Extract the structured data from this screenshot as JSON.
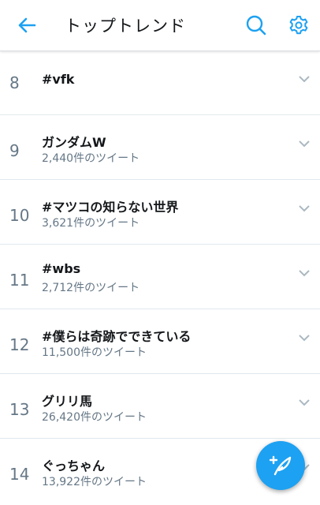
{
  "header": {
    "title": "トップトレンド"
  },
  "trends": [
    {
      "rank": "8",
      "name": "#vfk",
      "count": ""
    },
    {
      "rank": "9",
      "name": "ガンダムW",
      "count": "2,440件のツイート"
    },
    {
      "rank": "10",
      "name": "#マツコの知らない世界",
      "count": "3,621件のツイート"
    },
    {
      "rank": "11",
      "name": "#wbs",
      "count": "2,712件のツイート"
    },
    {
      "rank": "12",
      "name": "#僕らは奇跡でできている",
      "count": "11,500件のツイート"
    },
    {
      "rank": "13",
      "name": "グリリ馬",
      "count": "26,420件のツイート"
    },
    {
      "rank": "14",
      "name": "ぐっちゃん",
      "count": "13,922件のツイート"
    }
  ],
  "colors": {
    "accent": "#1da1f2",
    "text": "#14171a",
    "secondary": "#657786"
  },
  "icons": {
    "back": "arrow-left-icon",
    "search": "search-icon",
    "settings": "gear-icon",
    "expand": "chevron-down-icon",
    "compose": "feather-plus-icon"
  }
}
